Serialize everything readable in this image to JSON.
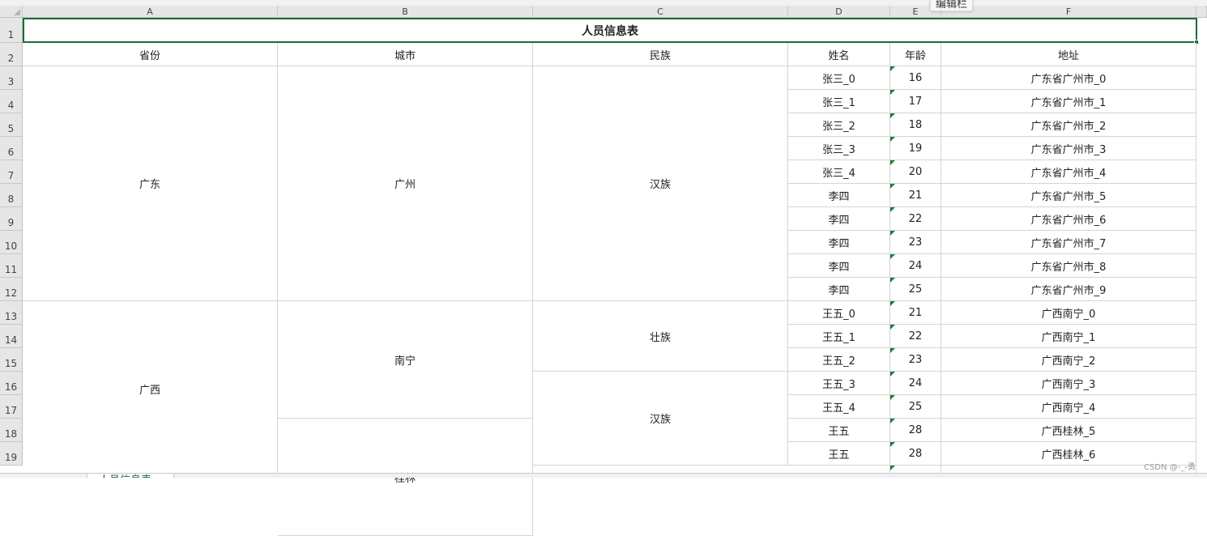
{
  "tooltip": "编辑栏",
  "columns": [
    "A",
    "B",
    "C",
    "D",
    "E",
    "F"
  ],
  "rows": [
    "1",
    "2",
    "3",
    "4",
    "5",
    "6",
    "7",
    "8",
    "9",
    "10",
    "11",
    "12",
    "13",
    "14",
    "15",
    "16",
    "17",
    "18",
    "19"
  ],
  "title": "人员信息表",
  "headers": [
    "省份",
    "城市",
    "民族",
    "姓名",
    "年龄",
    "地址"
  ],
  "province_cells": [
    "广东",
    "广西"
  ],
  "city_cells": [
    "广州",
    "南宁",
    "桂林"
  ],
  "ethnicity_cells": [
    "汉族",
    "壮族",
    "汉族"
  ],
  "records": [
    {
      "name": "张三_0",
      "age": "16",
      "address": "广东省广州市_0"
    },
    {
      "name": "张三_1",
      "age": "17",
      "address": "广东省广州市_1"
    },
    {
      "name": "张三_2",
      "age": "18",
      "address": "广东省广州市_2"
    },
    {
      "name": "张三_3",
      "age": "19",
      "address": "广东省广州市_3"
    },
    {
      "name": "张三_4",
      "age": "20",
      "address": "广东省广州市_4"
    },
    {
      "name": "李四",
      "age": "21",
      "address": "广东省广州市_5"
    },
    {
      "name": "李四",
      "age": "22",
      "address": "广东省广州市_6"
    },
    {
      "name": "李四",
      "age": "23",
      "address": "广东省广州市_7"
    },
    {
      "name": "李四",
      "age": "24",
      "address": "广东省广州市_8"
    },
    {
      "name": "李四",
      "age": "25",
      "address": "广东省广州市_9"
    },
    {
      "name": "王五_0",
      "age": "21",
      "address": "广西南宁_0"
    },
    {
      "name": "王五_1",
      "age": "22",
      "address": "广西南宁_1"
    },
    {
      "name": "王五_2",
      "age": "23",
      "address": "广西南宁_2"
    },
    {
      "name": "王五_3",
      "age": "24",
      "address": "广西南宁_3"
    },
    {
      "name": "王五_4",
      "age": "25",
      "address": "广西南宁_4"
    },
    {
      "name": "王五",
      "age": "28",
      "address": "广西桂林_5"
    },
    {
      "name": "王五",
      "age": "28",
      "address": "广西桂林_6"
    }
  ],
  "sheet_tab": "人员信息表",
  "watermark": "CSDN @-_-勇"
}
